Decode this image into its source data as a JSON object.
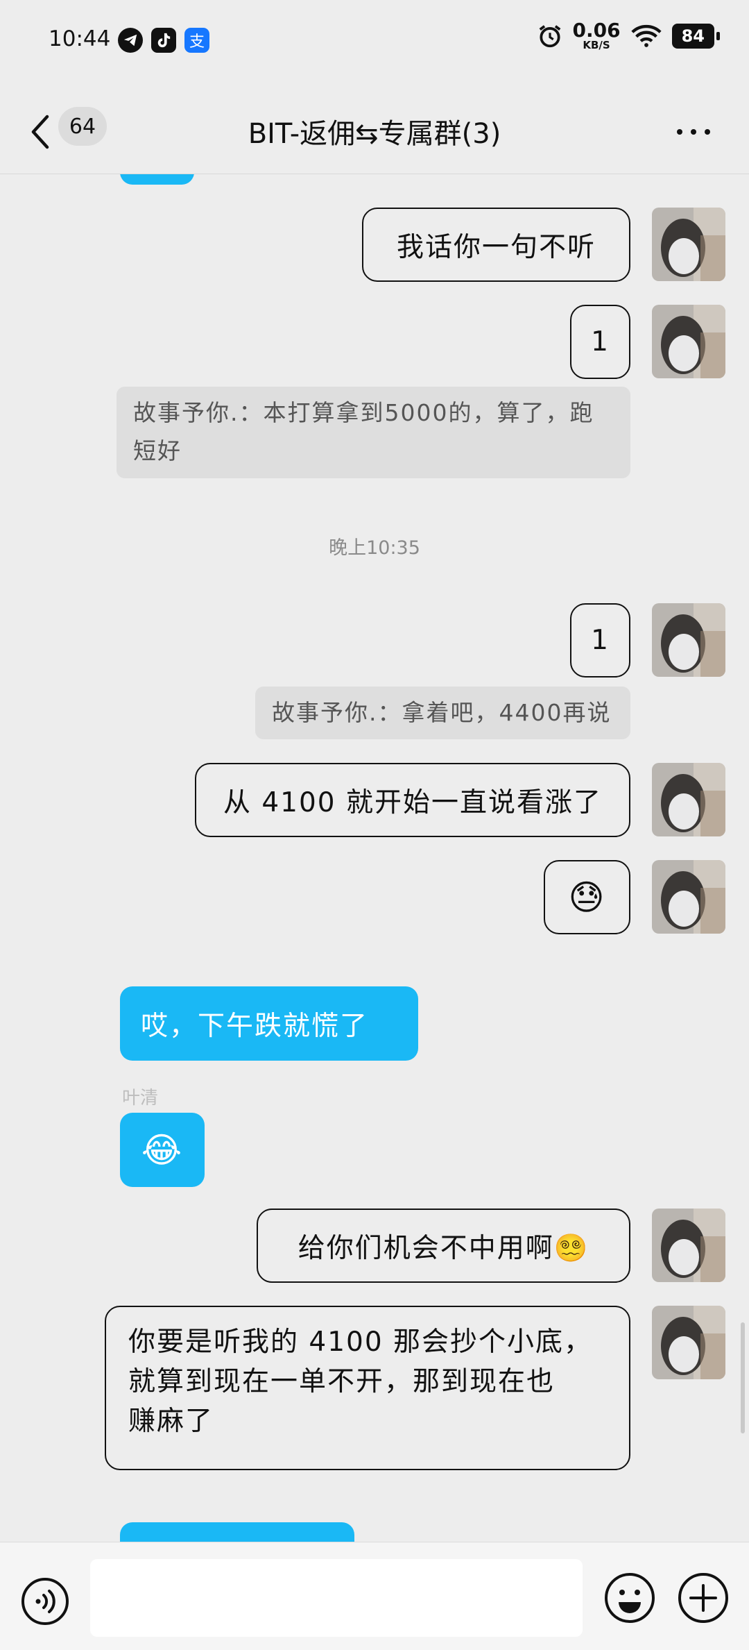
{
  "status_bar": {
    "time": "10:44",
    "apps": [
      "telegram-icon",
      "tiktok-icon",
      "alipay-icon"
    ],
    "alipay_glyph": "支",
    "net_speed_value": "0.06",
    "net_speed_unit": "KB/S",
    "battery": "84"
  },
  "header": {
    "back_icon": "chevron-left-icon",
    "unread_count": "64",
    "title": "BIT-返佣⇆专属群(3)",
    "more_icon": "more-horizontal-icon"
  },
  "messages": {
    "m1": "我话你一句不听",
    "m2": "1",
    "q1_line1": "故事予你.：本打算拿到5000的，算了，跑",
    "q1_line2": "短好",
    "time_sep": "晚上10:35",
    "m3": "1",
    "q2": "故事予你.：拿着吧，4400再说",
    "m4": "从 4100 就开始一直说看涨了",
    "m5": "😓",
    "m6": "哎，下午跌就慌了",
    "sender_2": "叶清",
    "m7": "😂",
    "m8": "给你们机会不中用啊😵‍💫",
    "m9_line1": "你要是听我的 4100 那会抄个小底，",
    "m9_line2": "就算到现在一单不开，那到现在也",
    "m9_line3": "赚麻了"
  },
  "bottom_bar": {
    "voice_icon": "voice-icon",
    "emoji_icon": "emoji-icon",
    "plus_icon": "plus-icon",
    "input_value": ""
  },
  "colors": {
    "incoming_bubble": "#1ab8f5",
    "background": "#ededed",
    "outgoing_border": "#111111"
  }
}
